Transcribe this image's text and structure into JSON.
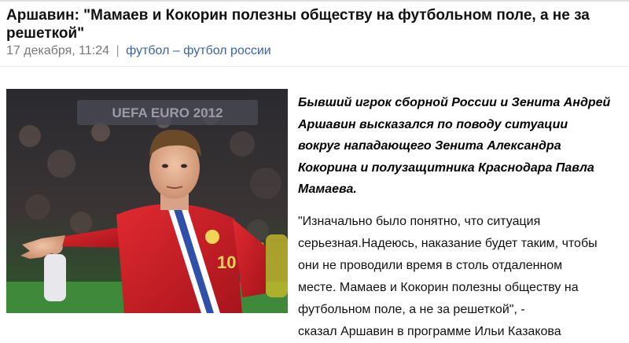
{
  "article": {
    "title": "Аршавин: \"Мамаев и Кокорин полезны обществу на футбольном поле, а не за решеткой\"",
    "date": "17 декабря, 11:24",
    "separator": "|",
    "category": "футбол",
    "category_dash": "–",
    "subcategory": "футбол россии",
    "lead": "Бывший игрок сборной России и Зенита Андрей Аршавин высказался по поводу ситуации вокруг нападающего Зенита Александра Кокорина и полузащитника Краснодара Павла Мамаева.",
    "quote_lines": [
      "\"Изначально было понятно, что ситуация",
      "серьезная.Надеюсь, наказание будет таким, чтобы",
      "они не проводили время в столь отдаленном",
      "месте. Мамаев и Кокорин полезны обществу на",
      "футбольном поле, а не за решеткой\", -",
      "сказал Аршавин в программе Ильи Казакова"
    ],
    "photo": {
      "banner_text": "UEFA EURO 2012",
      "shirt_number": "10"
    }
  },
  "colors": {
    "link": "#3b63a8",
    "shirt": "#d21f2b",
    "pitch": "#3f8a3a"
  }
}
